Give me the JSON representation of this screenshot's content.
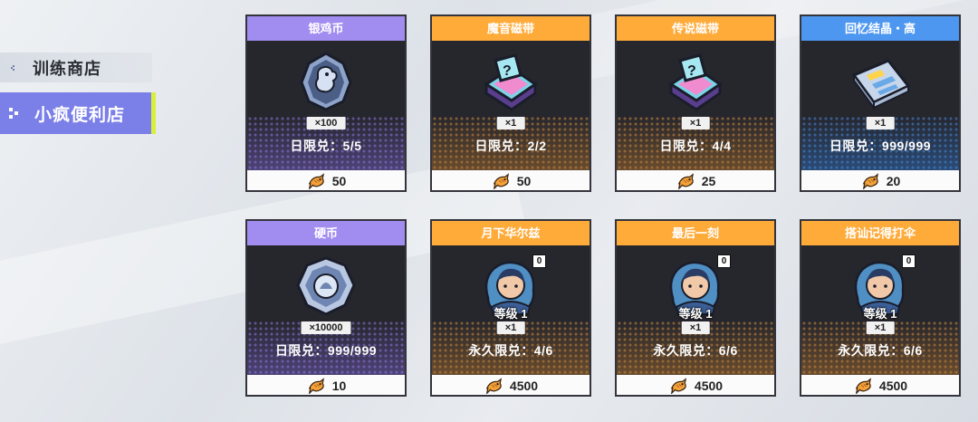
{
  "sidebar": {
    "items": [
      {
        "label": "训练商店",
        "icon": "chevron-left-icon",
        "active": false
      },
      {
        "label": "小疯便利店",
        "icon": "pixel-arrow-icon",
        "active": true
      }
    ]
  },
  "shop": {
    "currency_icon": "fried-fish-coin-icon",
    "items": [
      {
        "name": "银鸡币",
        "header_color": "#a18cf0",
        "icon": "silver-chicken-coin-icon",
        "qty": "×100",
        "limit": "日限兑：5/5",
        "price": "50"
      },
      {
        "name": "魔音磁带",
        "header_color": "#ffab3a",
        "icon": "mystery-tape-box-icon",
        "qty": "×1",
        "limit": "日限兑：2/2",
        "price": "50"
      },
      {
        "name": "传说磁带",
        "header_color": "#ffab3a",
        "icon": "mystery-tape-box-icon",
        "qty": "×1",
        "limit": "日限兑：4/4",
        "price": "25"
      },
      {
        "name": "回忆结晶・高",
        "header_color": "#4d97f0",
        "icon": "memory-crystal-document-icon",
        "qty": "×1",
        "limit": "日限兑：999/999",
        "price": "20"
      },
      {
        "name": "硬币",
        "header_color": "#a18cf0",
        "icon": "coin-icon",
        "qty": "×10000",
        "limit": "日限兑：999/999",
        "price": "10"
      },
      {
        "name": "月下华尔兹",
        "header_color": "#ffab3a",
        "icon": "character-portrait-icon",
        "badge": "0",
        "level": "等级 1",
        "qty": "×1",
        "limit": "永久限兑：4/6",
        "price": "4500"
      },
      {
        "name": "最后一刻",
        "header_color": "#ffab3a",
        "icon": "character-portrait-icon",
        "badge": "0",
        "level": "等级 1",
        "qty": "×1",
        "limit": "永久限兑：6/6",
        "price": "4500"
      },
      {
        "name": "搭讪记得打伞",
        "header_color": "#ffab3a",
        "icon": "character-portrait-icon",
        "badge": "0",
        "level": "等级 1",
        "qty": "×1",
        "limit": "永久限兑：6/6",
        "price": "4500"
      }
    ]
  }
}
